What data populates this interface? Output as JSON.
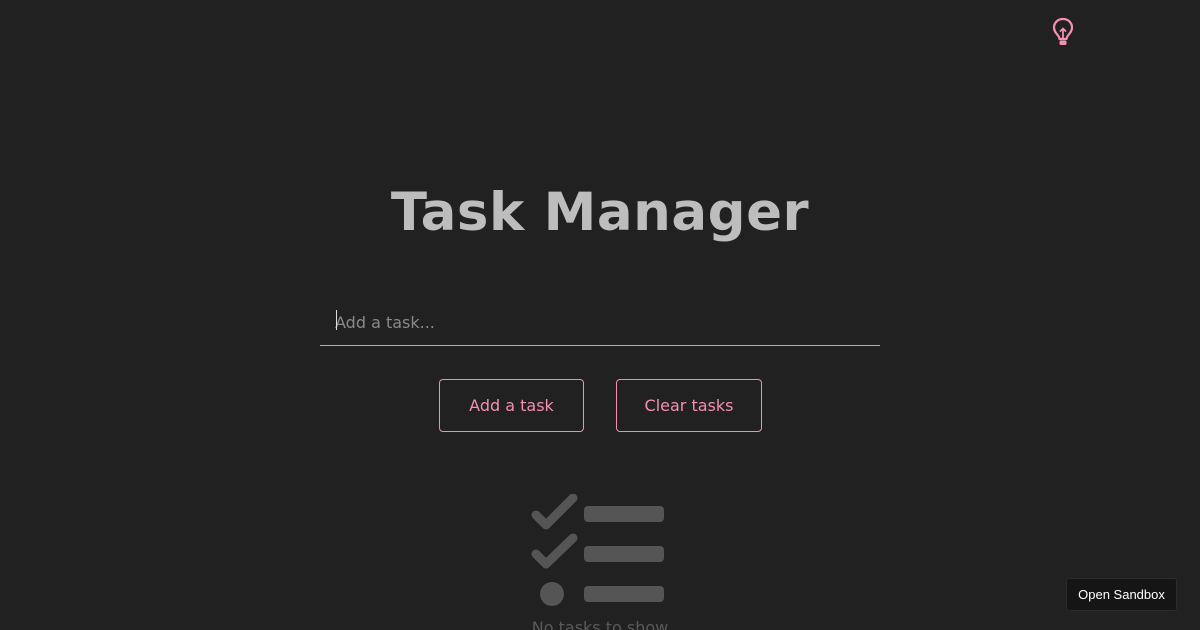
{
  "header": {
    "theme_toggle_icon": "lightbulb-icon"
  },
  "main": {
    "title": "Task Manager",
    "task_input": {
      "value": "",
      "placeholder": "Add a task..."
    },
    "buttons": {
      "add_label": "Add a task",
      "clear_label": "Clear tasks"
    },
    "empty_state": {
      "illustration_icon": "task-list-illustration-icon",
      "text": "No tasks to show"
    }
  },
  "footer": {
    "sandbox_label": "Open Sandbox"
  },
  "colors": {
    "background": "#212121",
    "accent": "#f48fb1",
    "title": "#bdbdbd",
    "illustration": "#555555"
  }
}
